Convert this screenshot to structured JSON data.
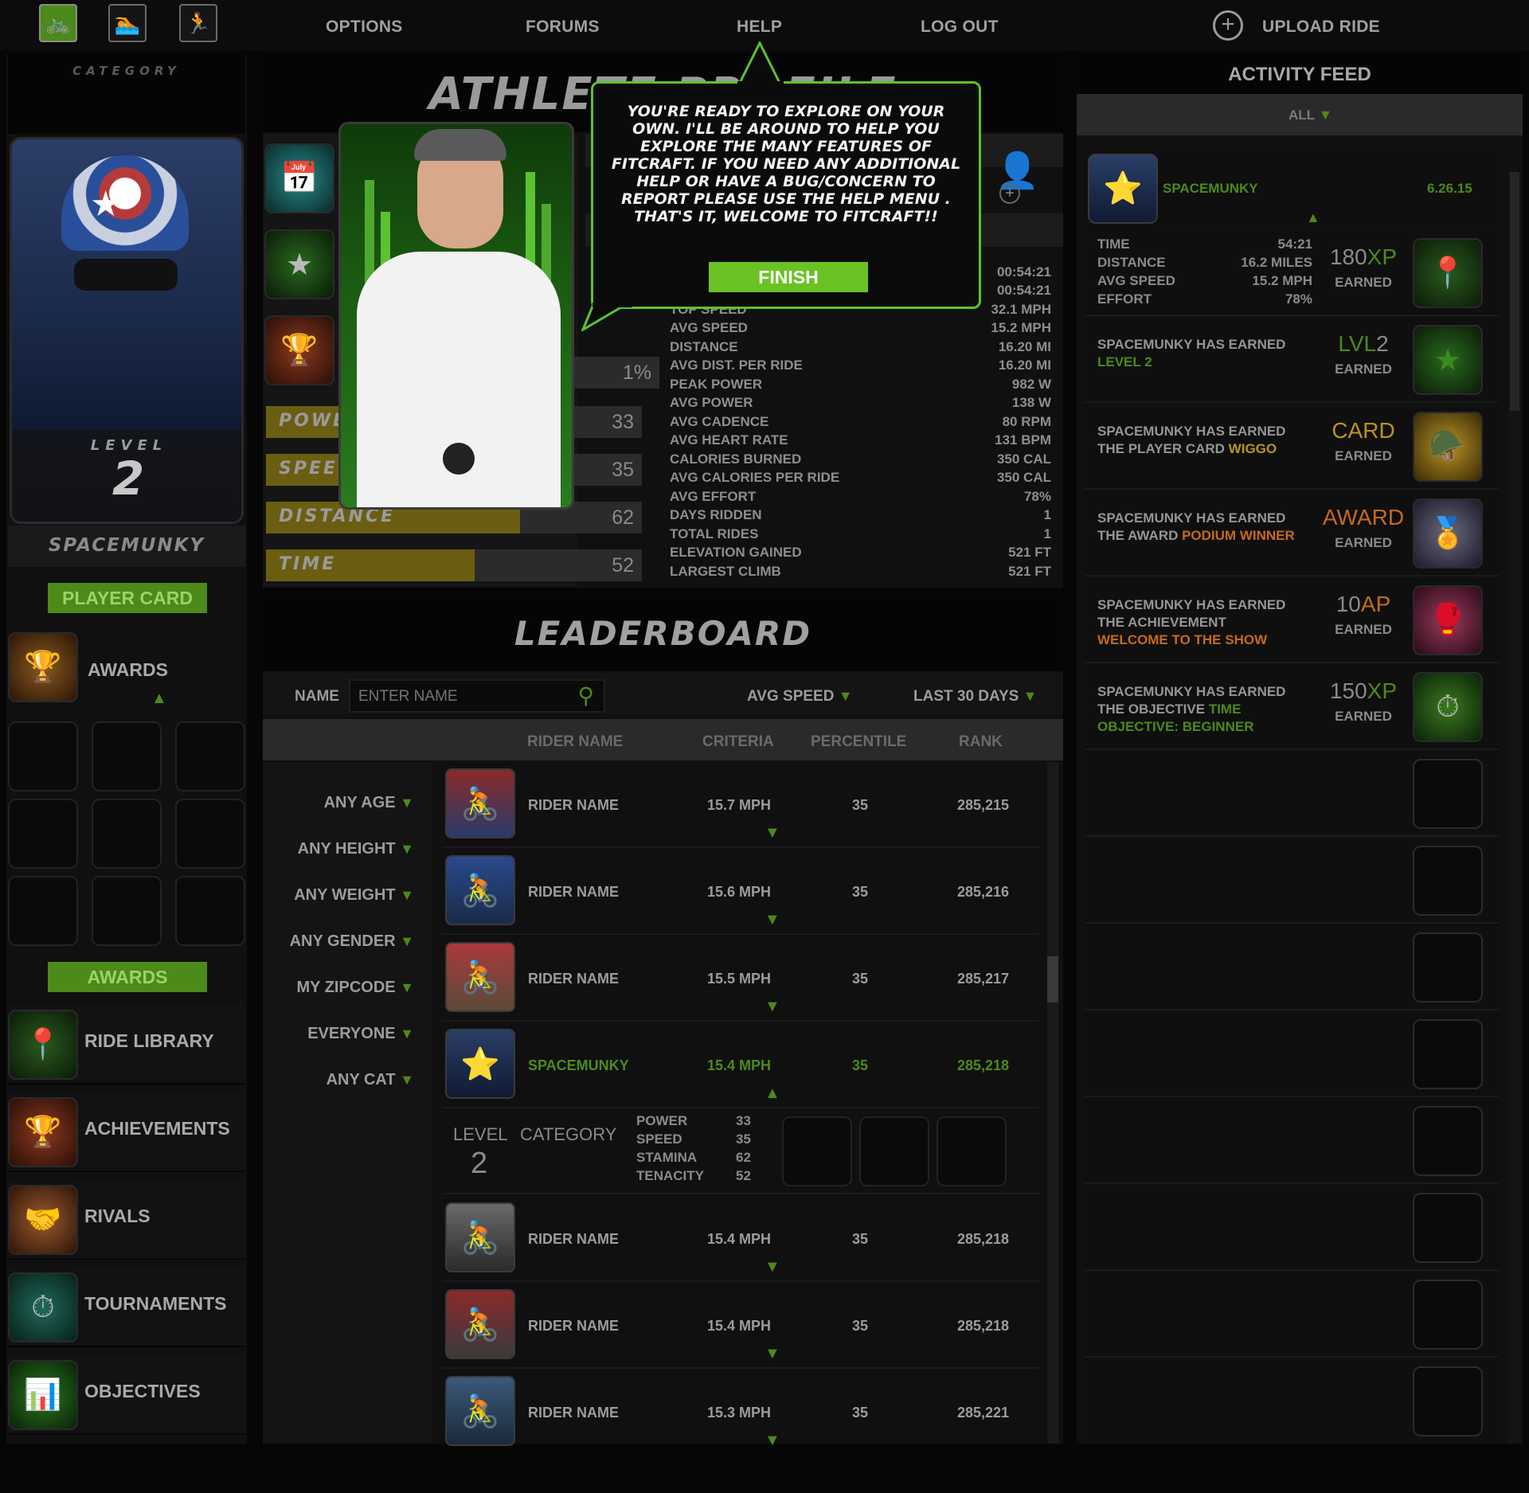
{
  "nav": {
    "modes": [
      {
        "icon": "bike-icon",
        "glyph": "🚲"
      },
      {
        "icon": "swim-icon",
        "glyph": "🏊"
      },
      {
        "icon": "run-icon",
        "glyph": "🏃"
      }
    ],
    "links": [
      "OPTIONS",
      "FORUMS",
      "HELP",
      "LOG OUT"
    ],
    "upload": "UPLOAD RIDE"
  },
  "left": {
    "category_label": "CATEGORY",
    "level_label": "LEVEL",
    "level_value": "2",
    "username": "SPACEMUNKY",
    "player_card_button": "PLAYER CARD",
    "awards_title": "AWARDS",
    "awards_button": "AWARDS",
    "menu": [
      {
        "label": "RIDE LIBRARY",
        "icon": "map-pin-icon",
        "glyph": "📍"
      },
      {
        "label": "ACHIEVEMENTS",
        "icon": "trophy-icon",
        "glyph": "🏆"
      },
      {
        "label": "RIVALS",
        "icon": "handshake-icon",
        "glyph": "🤝"
      },
      {
        "label": "TOURNAMENTS",
        "icon": "stopwatch-icon",
        "glyph": "⏱"
      },
      {
        "label": "OBJECTIVES",
        "icon": "chart-icon",
        "glyph": "📊"
      }
    ]
  },
  "profile": {
    "title": "ATHLETE PROFILE",
    "percent_box": "1%",
    "bars": [
      {
        "label": "POWER",
        "value": 33
      },
      {
        "label": "SPEED",
        "value": 35
      },
      {
        "label": "DISTANCE",
        "value": 62
      },
      {
        "label": "TIME",
        "value": 52
      }
    ],
    "stats": [
      {
        "label": "",
        "value": "00:54:21"
      },
      {
        "label": "",
        "value": "00:54:21"
      },
      {
        "label": "TOP SPEED",
        "value": "32.1 MPH"
      },
      {
        "label": "AVG SPEED",
        "value": "15.2 MPH"
      },
      {
        "label": "DISTANCE",
        "value": "16.20 MI"
      },
      {
        "label": "AVG DIST. PER RIDE",
        "value": "16.20 MI"
      },
      {
        "label": "PEAK POWER",
        "value": "982 W"
      },
      {
        "label": "AVG POWER",
        "value": "138 W"
      },
      {
        "label": "AVG CADENCE",
        "value": "80 RPM"
      },
      {
        "label": "AVG HEART RATE",
        "value": "131 BPM"
      },
      {
        "label": "CALORIES BURNED",
        "value": "350 CAL"
      },
      {
        "label": "AVG CALORIES PER RIDE",
        "value": "350 CAL"
      },
      {
        "label": "AVG EFFORT",
        "value": "78%"
      },
      {
        "label": "DAYS RIDDEN",
        "value": "1"
      },
      {
        "label": "TOTAL RIDES",
        "value": "1"
      },
      {
        "label": "ELEVATION GAINED",
        "value": "521 FT"
      },
      {
        "label": "LARGEST CLIMB",
        "value": "521 FT"
      }
    ]
  },
  "tutorial": {
    "message": "YOU'RE READY TO EXPLORE ON YOUR OWN. I'LL BE AROUND TO HELP YOU EXPLORE THE MANY FEATURES OF FITCRAFT.  IF YOU NEED ANY ADDITIONAL HELP OR HAVE A BUG/CONCERN TO REPORT PLEASE USE THE HELP MENU .  THAT'S IT, WELCOME TO FITCRAFT!!",
    "finish": "FINISH"
  },
  "leaderboard": {
    "title": "LEADERBOARD",
    "name_label": "NAME",
    "name_placeholder": "ENTER NAME",
    "criteria_select": "AVG SPEED",
    "period_select": "LAST 30 DAYS",
    "headers": [
      "RIDER NAME",
      "CRITERIA",
      "PERCENTILE",
      "RANK"
    ],
    "filters": [
      "ANY AGE",
      "ANY HEIGHT",
      "ANY WEIGHT",
      "ANY GENDER",
      "MY ZIPCODE",
      "EVERYONE",
      "ANY CAT"
    ],
    "rows": [
      {
        "name": "RIDER NAME",
        "criteria": "15.7 MPH",
        "percentile": "35",
        "rank": "285,215"
      },
      {
        "name": "RIDER NAME",
        "criteria": "15.6 MPH",
        "percentile": "35",
        "rank": "285,216"
      },
      {
        "name": "RIDER NAME",
        "criteria": "15.5 MPH",
        "percentile": "35",
        "rank": "285,217"
      },
      {
        "name": "SPACEMUNKY",
        "criteria": "15.4 MPH",
        "percentile": "35",
        "rank": "285,218"
      },
      {
        "name": "RIDER NAME",
        "criteria": "15.4 MPH",
        "percentile": "35",
        "rank": "285,218"
      },
      {
        "name": "RIDER NAME",
        "criteria": "15.4 MPH",
        "percentile": "35",
        "rank": "285,218"
      },
      {
        "name": "RIDER NAME",
        "criteria": "15.3 MPH",
        "percentile": "35",
        "rank": "285,221"
      }
    ],
    "detail": {
      "level_label": "LEVEL",
      "level_value": "2",
      "category_label": "CATEGORY",
      "stats": [
        {
          "label": "POWER",
          "value": "33"
        },
        {
          "label": "SPEED",
          "value": "35"
        },
        {
          "label": "STAMINA",
          "value": "62"
        },
        {
          "label": "TENACITY",
          "value": "52"
        }
      ]
    }
  },
  "feed": {
    "title": "ACTIVITY FEED",
    "filter": "ALL",
    "user": "SPACEMUNKY",
    "date": "6.26.15",
    "ride": [
      {
        "label": "TIME",
        "value": "54:21"
      },
      {
        "label": "DISTANCE",
        "value": "16.2 MILES"
      },
      {
        "label": "AVG SPEED",
        "value": "15.2 MPH"
      },
      {
        "label": "EFFORT",
        "value": "78%"
      }
    ],
    "ride_reward_num": "180",
    "ride_reward_unit": "XP",
    "earned": "EARNED",
    "items": [
      {
        "line1": "SPACEMUNKY HAS EARNED",
        "line2": "",
        "highlight": "LEVEL 2",
        "big_num": "",
        "big_unit": "LVL",
        "big_num2": "2",
        "icon": "star-icon",
        "glyph": "★"
      },
      {
        "line1": "SPACEMUNKY HAS EARNED",
        "line2": "THE PLAYER CARD ",
        "highlight": "WIGGO",
        "big_num": "",
        "big_unit": "CARD",
        "big_num2": "",
        "icon": "player-card-icon",
        "glyph": "🪖"
      },
      {
        "line1": "SPACEMUNKY HAS EARNED",
        "line2": "THE AWARD ",
        "highlight": "PODIUM WINNER",
        "big_num": "",
        "big_unit": "AWARD",
        "big_num2": "",
        "icon": "podium-icon",
        "glyph": "🏅"
      },
      {
        "line1": "SPACEMUNKY HAS EARNED",
        "line2": "THE ACHIEVEMENT",
        "highlight": "WELCOME TO THE SHOW",
        "big_num": "10",
        "big_unit": "AP",
        "big_num2": "",
        "icon": "gloves-icon",
        "glyph": "🥊"
      },
      {
        "line1": "SPACEMUNKY HAS EARNED",
        "line2": "THE OBJECTIVE ",
        "highlight": "TIME OBJECTIVE: BEGINNER",
        "big_num": "150",
        "big_unit": "XP",
        "big_num2": "",
        "icon": "stopwatch-icon",
        "glyph": "⏱"
      }
    ]
  },
  "colors": {
    "accent_green": "#4c8a19",
    "bright_green": "#7ad62a",
    "gold": "#b89423",
    "orange": "#c46a1c",
    "bg": "#060606"
  }
}
